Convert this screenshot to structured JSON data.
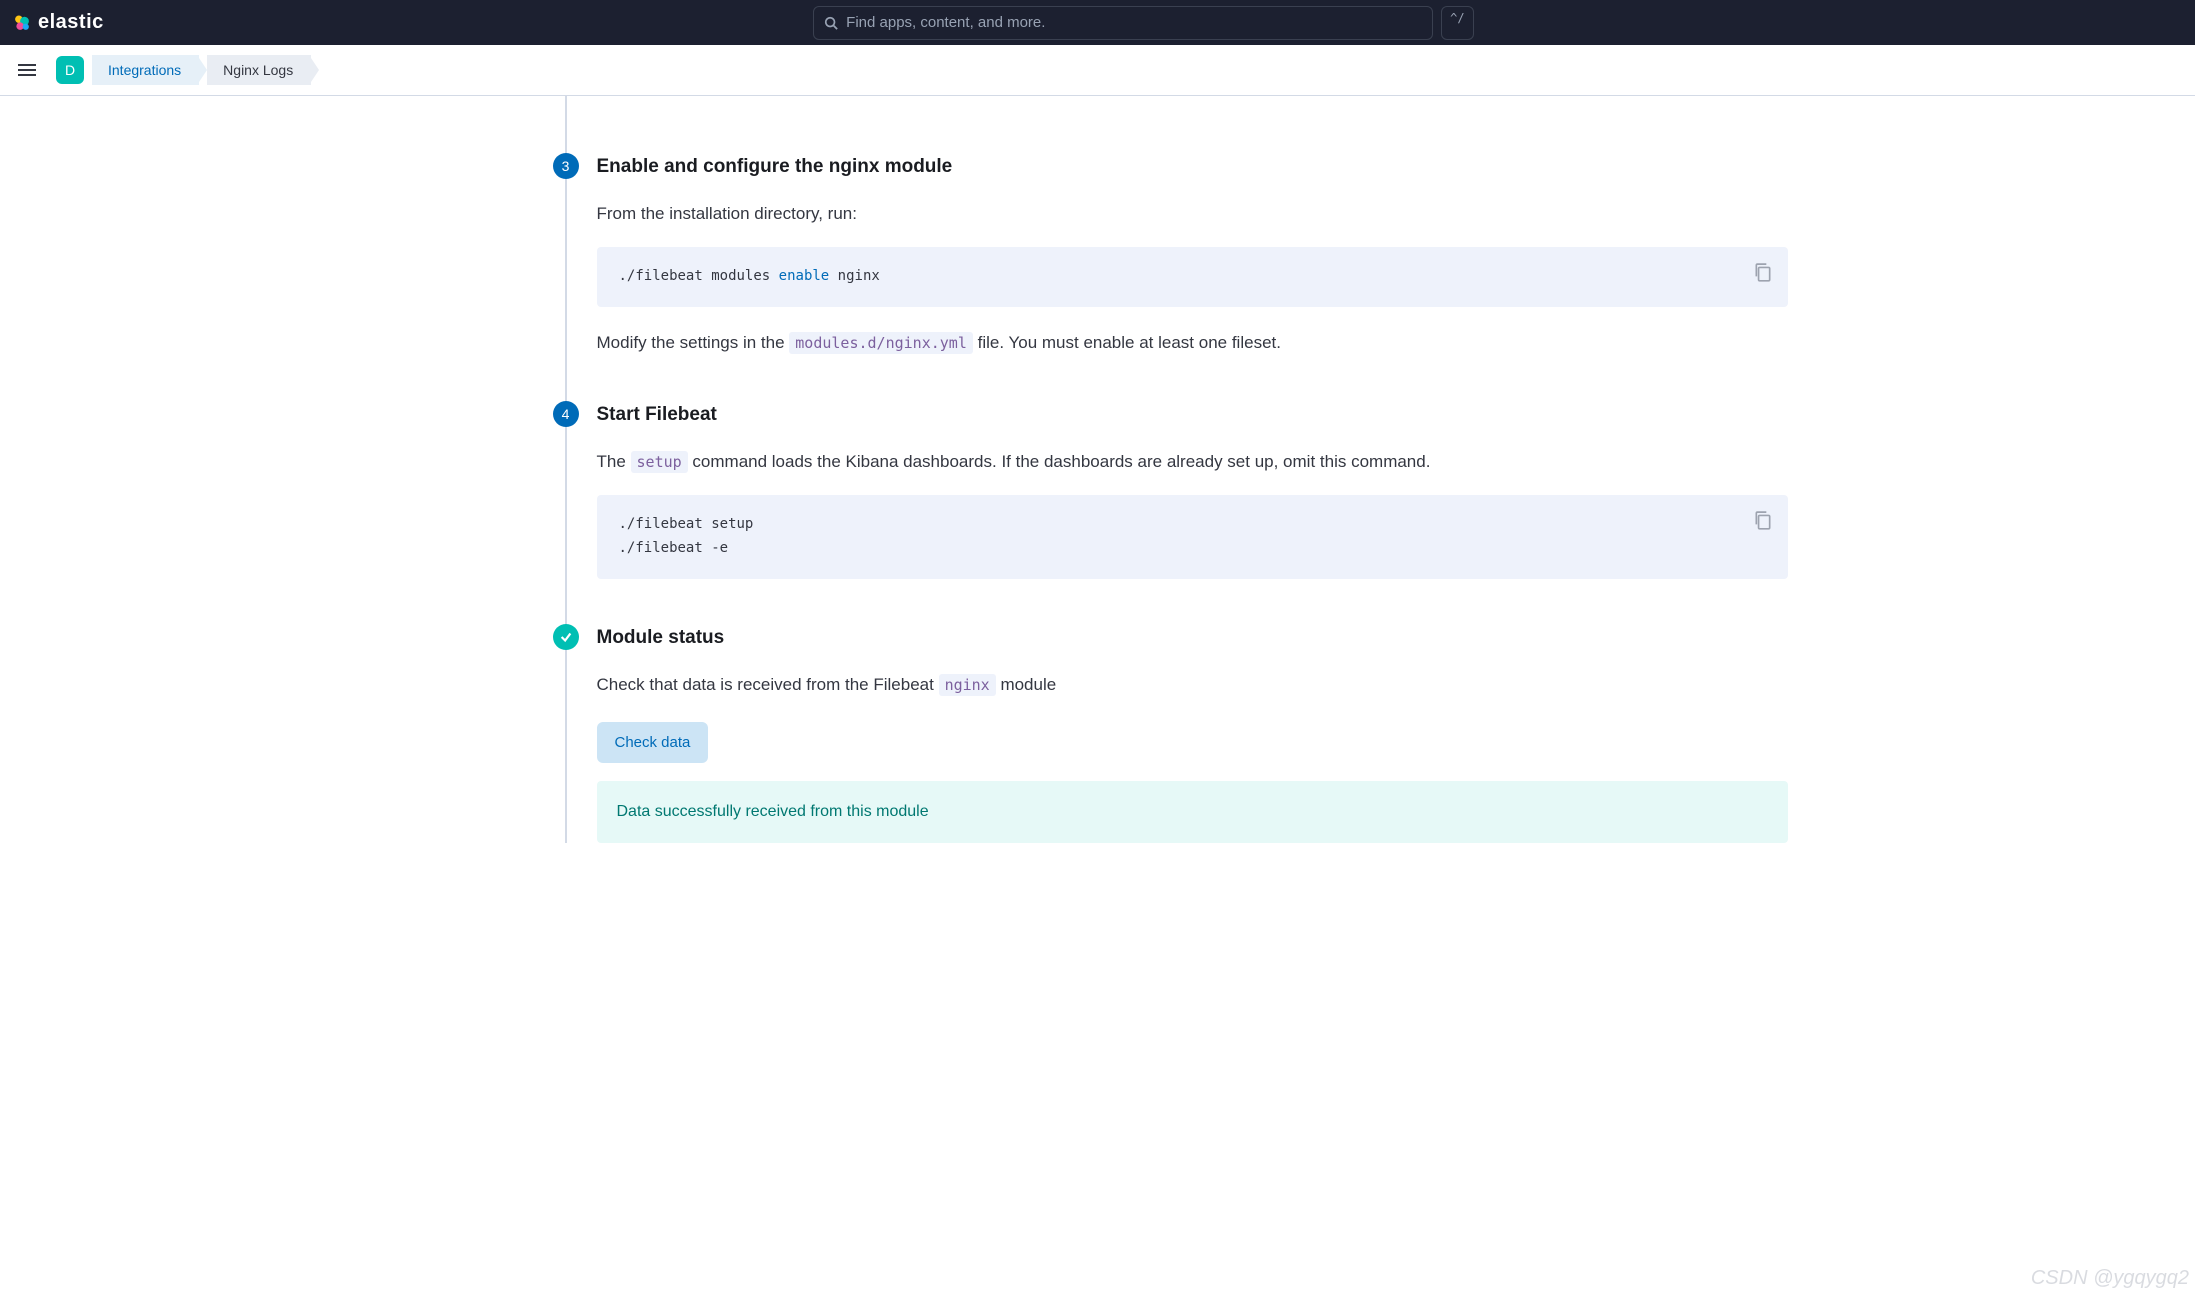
{
  "header": {
    "logo_text": "elastic",
    "search_placeholder": "Find apps, content, and more.",
    "kbd_shortcut": "^/"
  },
  "subheader": {
    "avatar_letter": "D",
    "breadcrumbs": [
      {
        "label": "Integrations",
        "link": true
      },
      {
        "label": "Nginx Logs",
        "link": false
      }
    ]
  },
  "steps": {
    "s3": {
      "num": "3",
      "title": "Enable and configure the nginx module",
      "intro": "From the installation directory, run:",
      "code_prefix": "./filebeat modules ",
      "code_keyword": "enable",
      "code_suffix": " nginx",
      "desc_pre": "Modify the settings in the ",
      "desc_code": "modules.d/nginx.yml",
      "desc_post": " file. You must enable at least one fileset."
    },
    "s4": {
      "num": "4",
      "title": "Start Filebeat",
      "desc_pre": "The ",
      "desc_code": "setup",
      "desc_post": " command loads the Kibana dashboards. If the dashboards are already set up, omit this command.",
      "code": "./filebeat setup\n./filebeat -e"
    },
    "status": {
      "title": "Module status",
      "desc_pre": "Check that data is received from the Filebeat ",
      "desc_code": "nginx",
      "desc_post": " module",
      "button": "Check data",
      "success": "Data successfully received from this module"
    }
  },
  "watermark": "CSDN @ygqygq2"
}
